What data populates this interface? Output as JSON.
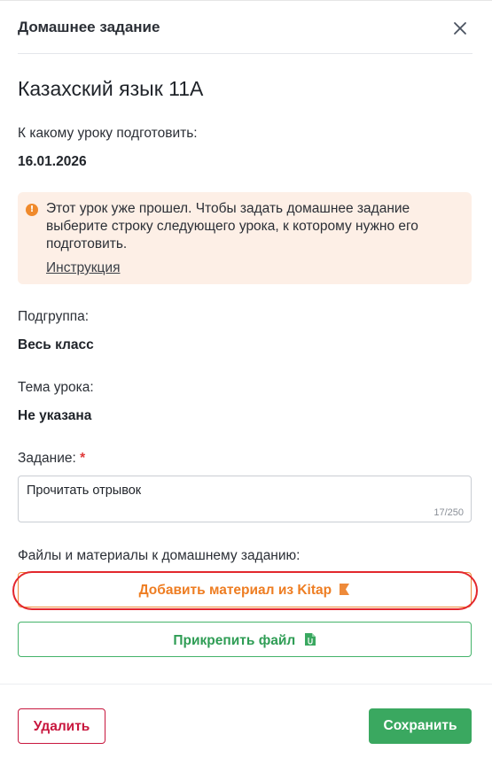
{
  "header": {
    "title": "Домашнее задание",
    "close_icon": "close-icon"
  },
  "subject": "Казахский язык 11А",
  "lesson": {
    "label": "К какому уроку подготовить:",
    "value": "16.01.2026"
  },
  "warning": {
    "icon": "exclamation-icon",
    "text": "Этот урок уже прошел. Чтобы задать домашнее задание выберите строку следующего урока, к которому нужно его подготовить.",
    "link": "Инструкция",
    "icon_glyph": "!"
  },
  "subgroup": {
    "label": "Подгруппа:",
    "value": "Весь класс"
  },
  "topic": {
    "label": "Тема урока:",
    "value": "Не указана"
  },
  "task": {
    "label": "Задание:",
    "required_mark": "*",
    "value": "Прочитать отрывок",
    "counter": "17/250"
  },
  "files": {
    "label": "Файлы и материалы к домашнему заданию:",
    "kitap_button": "Добавить материал из Kitap",
    "attach_button": "Прикрепить файл"
  },
  "footer": {
    "delete_button": "Удалить",
    "save_button": "Сохранить"
  },
  "colors": {
    "accent_green": "#3aa860",
    "accent_orange": "#ee7d22",
    "danger": "#c8173e",
    "warning_bg": "#fdefe6",
    "highlight": "#e3272d"
  }
}
